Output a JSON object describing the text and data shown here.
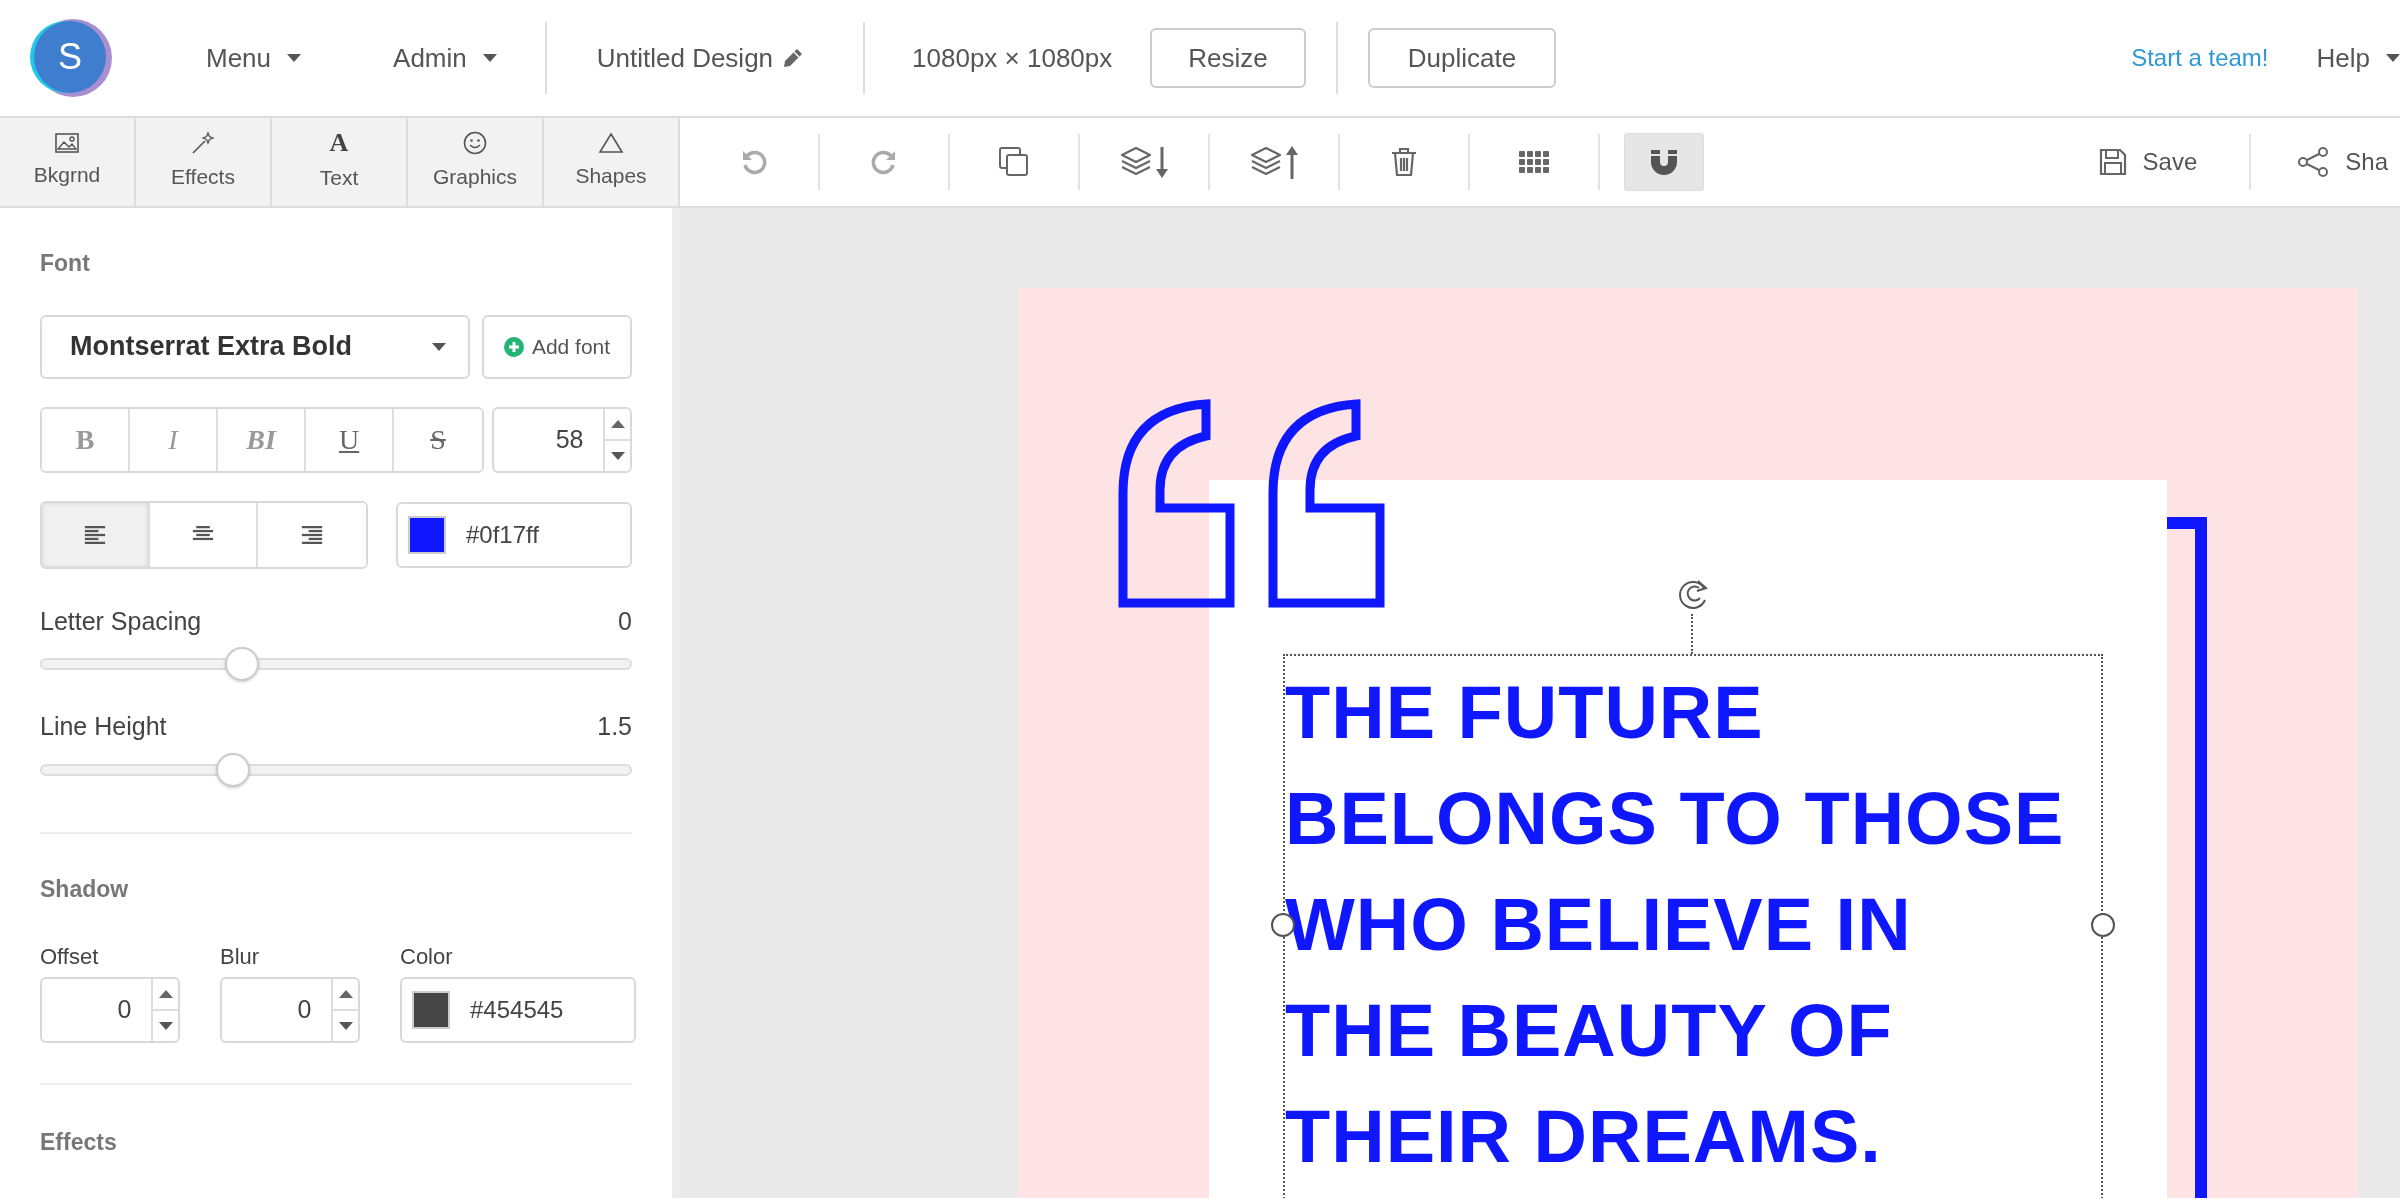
{
  "logo": {
    "letter": "S"
  },
  "top_menu": [
    {
      "label": "Menu"
    },
    {
      "label": "Admin"
    }
  ],
  "design_title": "Untitled Design",
  "dimensions": "1080px × 1080px",
  "top_buttons": [
    "Resize",
    "Duplicate"
  ],
  "team_link": "Start a team!",
  "help_menu": "Help",
  "panel_tabs": [
    {
      "label": "Bkgrnd",
      "kind": "image"
    },
    {
      "label": "Effects",
      "kind": "wand"
    },
    {
      "label": "Text",
      "kind": "glyph",
      "glyph": "A"
    },
    {
      "label": "Graphics",
      "kind": "smiley"
    },
    {
      "label": "Shapes",
      "kind": "triangle"
    }
  ],
  "toolbar": [
    {
      "kind": "undo",
      "disabled": true,
      "active": false
    },
    {
      "kind": "redo",
      "disabled": true,
      "active": false
    },
    {
      "kind": "copy",
      "disabled": false,
      "active": false
    },
    {
      "kind": "layer-down",
      "disabled": false,
      "active": false
    },
    {
      "kind": "layer-up",
      "disabled": false,
      "active": false
    },
    {
      "kind": "trash",
      "disabled": false,
      "active": false
    },
    {
      "kind": "grid",
      "disabled": false,
      "active": false
    },
    {
      "kind": "magnet",
      "disabled": false,
      "active": true
    }
  ],
  "save": "Save",
  "share": "Sha",
  "font_panel": {
    "heading": "Font",
    "font_name": "Montserrat Extra Bold",
    "add_font": "Add font",
    "styles": [
      {
        "label": "B",
        "kind": "bold"
      },
      {
        "label": "I",
        "kind": "italic"
      },
      {
        "label": "BI",
        "kind": "bold-italic"
      },
      {
        "label": "U",
        "kind": "underline"
      },
      {
        "label": "S",
        "kind": "strike"
      }
    ],
    "size": "58",
    "alignments": [
      {
        "kind": "left",
        "selected": true
      },
      {
        "kind": "center",
        "selected": false
      },
      {
        "kind": "right",
        "selected": false
      }
    ],
    "color": "#0f17ff",
    "sliders": [
      {
        "label": "Letter Spacing",
        "reading": "0",
        "level": 0.34
      },
      {
        "label": "Line Height",
        "reading": "1.5",
        "level": 0.325
      }
    ]
  },
  "shadow": {
    "heading": "Shadow",
    "offset": {
      "label": "Offset",
      "value": "0"
    },
    "blur": {
      "label": "Blur",
      "value": "0"
    },
    "color": {
      "label": "Color",
      "value": "#454545"
    }
  },
  "effects_heading": "Effects",
  "canvas": {
    "quote": "THE FUTURE\nBELONGS TO THOSE\nWHO BELIEVE IN\nTHE BEAUTY OF\nTHEIR DREAMS."
  }
}
